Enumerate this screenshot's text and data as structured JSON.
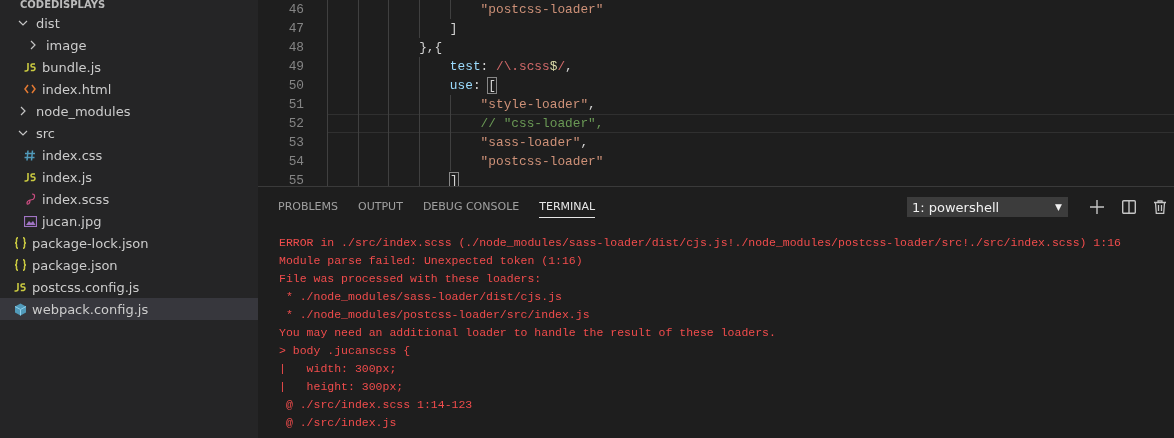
{
  "sidebar": {
    "header": "CODEDISPLAYS",
    "items": [
      {
        "kind": "folder",
        "label": "dist",
        "expanded": true,
        "selected": false,
        "children": [
          {
            "kind": "folder",
            "label": "image",
            "expanded": false,
            "selected": false
          },
          {
            "kind": "js",
            "label": "bundle.js",
            "selected": false
          },
          {
            "kind": "html",
            "label": "index.html",
            "selected": false
          }
        ]
      },
      {
        "kind": "folder",
        "label": "node_modules",
        "expanded": false,
        "selected": false
      },
      {
        "kind": "folder",
        "label": "src",
        "expanded": true,
        "selected": false,
        "children": [
          {
            "kind": "css",
            "label": "index.css",
            "selected": false
          },
          {
            "kind": "js",
            "label": "index.js",
            "selected": false
          },
          {
            "kind": "scss",
            "label": "index.scss",
            "selected": false
          },
          {
            "kind": "image",
            "label": "jucan.jpg",
            "selected": false
          }
        ]
      },
      {
        "kind": "json",
        "label": "package-lock.json",
        "selected": false
      },
      {
        "kind": "json",
        "label": "package.json",
        "selected": false
      },
      {
        "kind": "js",
        "label": "postcss.config.js",
        "selected": false
      },
      {
        "kind": "config",
        "label": "webpack.config.js",
        "selected": true
      }
    ]
  },
  "editor": {
    "lines": [
      {
        "number": "46",
        "current": false,
        "tokens": [
          {
            "kind": "string",
            "text": "                    \"postcss-loader\""
          }
        ]
      },
      {
        "number": "47",
        "current": false,
        "tokens": [
          {
            "kind": "plain",
            "text": "                ]"
          }
        ]
      },
      {
        "number": "48",
        "current": false,
        "tokens": [
          {
            "kind": "plain",
            "text": "            },{"
          }
        ]
      },
      {
        "number": "49",
        "current": false,
        "tokens": [
          {
            "kind": "key",
            "text": "                test"
          },
          {
            "kind": "plain",
            "text": ": "
          },
          {
            "kind": "regex",
            "text": "/\\.scss"
          },
          {
            "kind": "punct",
            "text": "$"
          },
          {
            "kind": "regex",
            "text": "/"
          },
          {
            "kind": "plain",
            "text": ","
          }
        ]
      },
      {
        "number": "50",
        "current": false,
        "tokens": [
          {
            "kind": "key",
            "text": "                use"
          },
          {
            "kind": "plain",
            "text": ": "
          },
          {
            "kind": "bracket-match",
            "text": "["
          }
        ]
      },
      {
        "number": "51",
        "current": false,
        "tokens": [
          {
            "kind": "string",
            "text": "                    \"style-loader\""
          },
          {
            "kind": "plain",
            "text": ","
          }
        ]
      },
      {
        "number": "52",
        "current": true,
        "tokens": [
          {
            "kind": "comment",
            "text": "                    // \"css-loader\","
          }
        ]
      },
      {
        "number": "53",
        "current": false,
        "tokens": [
          {
            "kind": "string",
            "text": "                    \"sass-loader\""
          },
          {
            "kind": "plain",
            "text": ","
          }
        ]
      },
      {
        "number": "54",
        "current": false,
        "tokens": [
          {
            "kind": "string",
            "text": "                    \"postcss-loader\""
          }
        ]
      },
      {
        "number": "55",
        "current": false,
        "tokens": [
          {
            "kind": "bracket-match",
            "text": "                ]"
          }
        ]
      }
    ]
  },
  "panel": {
    "tabs": [
      {
        "label": "PROBLEMS",
        "selected": false
      },
      {
        "label": "OUTPUT",
        "selected": false
      },
      {
        "label": "DEBUG CONSOLE",
        "selected": false
      },
      {
        "label": "TERMINAL",
        "selected": true
      }
    ],
    "terminal_select": {
      "value": "1: powershell",
      "arrow": "▼"
    },
    "terminal_lines": [
      "ERROR in ./src/index.scss (./node_modules/sass-loader/dist/cjs.js!./node_modules/postcss-loader/src!./src/index.scss) 1:16",
      "Module parse failed: Unexpected token (1:16)",
      "File was processed with these loaders:",
      " * ./node_modules/sass-loader/dist/cjs.js",
      " * ./node_modules/postcss-loader/src/index.js",
      "You may need an additional loader to handle the result of these loaders.",
      "> body .jucanscss {",
      "|   width: 300px;",
      "|   height: 300px;",
      " @ ./src/index.scss 1:14-123",
      " @ ./src/index.js"
    ]
  }
}
